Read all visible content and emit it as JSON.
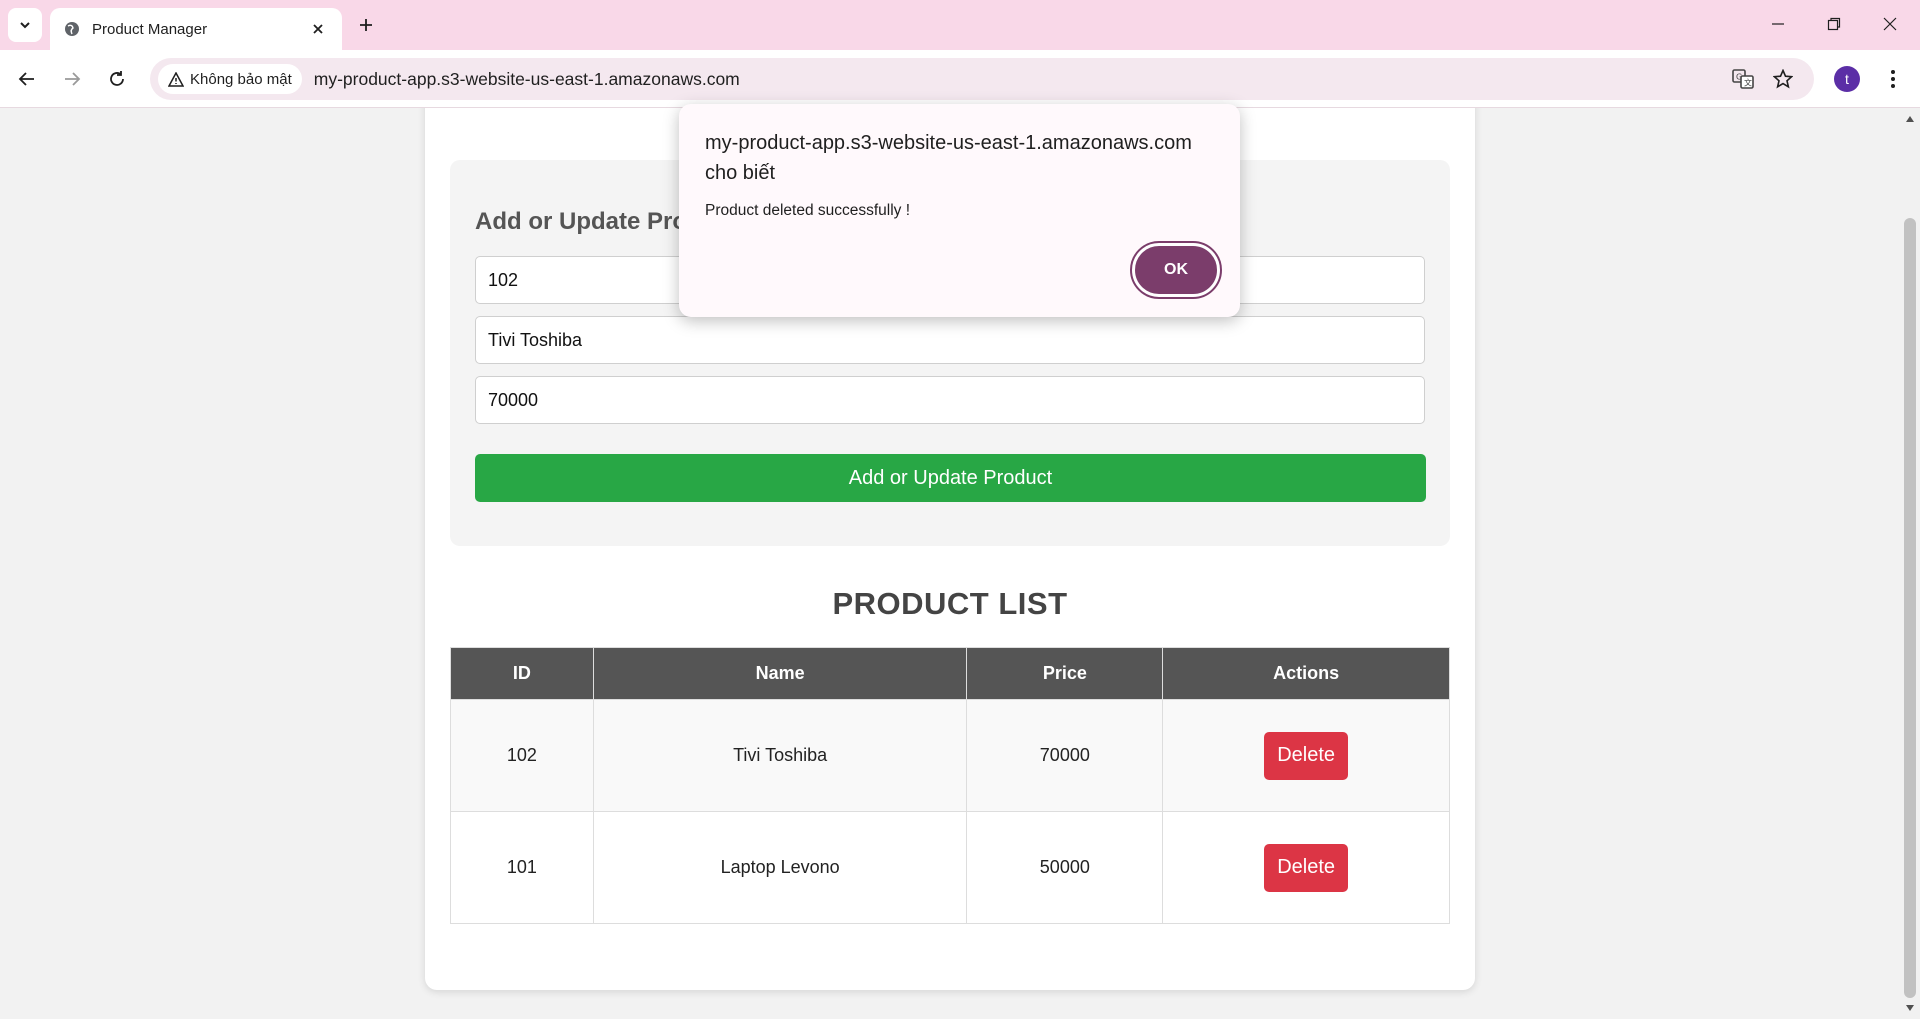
{
  "browser": {
    "tab_title": "Product Manager",
    "security_label": "Không bảo mật",
    "url": "my-product-app.s3-website-us-east-1.amazonaws.com",
    "profile_initial": "t"
  },
  "form": {
    "heading": "Add or Update Product",
    "id_value": "102",
    "name_value": "Tivi Toshiba",
    "price_value": "70000",
    "submit_label": "Add or Update Product"
  },
  "product_list": {
    "title": "PRODUCT LIST",
    "columns": [
      "ID",
      "Name",
      "Price",
      "Actions"
    ],
    "rows": [
      {
        "id": "102",
        "name": "Tivi Toshiba",
        "price": "70000",
        "action": "Delete"
      },
      {
        "id": "101",
        "name": "Laptop Levono",
        "price": "50000",
        "action": "Delete"
      }
    ]
  },
  "dialog": {
    "title": "my-product-app.s3-website-us-east-1.amazonaws.com cho biết",
    "message": "Product deleted successfully !",
    "ok_label": "OK"
  },
  "colors": {
    "tabstrip": "#f9d8e8",
    "submit_button": "#28a745",
    "delete_button": "#dc3545",
    "table_header": "#555555",
    "dialog_ok": "#7b3d6b"
  }
}
